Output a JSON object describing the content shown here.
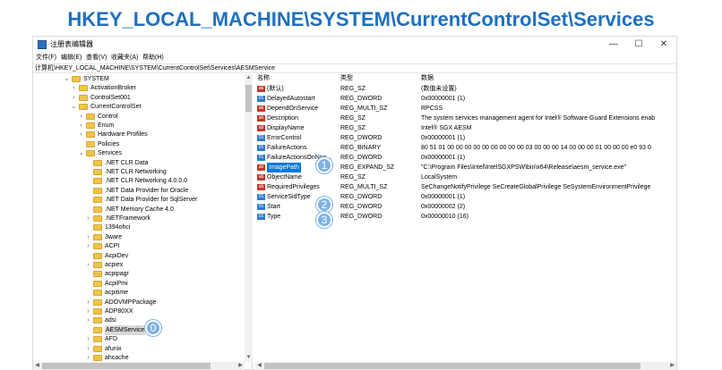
{
  "heading": "HKEY_LOCAL_MACHINE\\SYSTEM\\CurrentControlSet\\Services",
  "window": {
    "title": "注册表编辑器",
    "controls": {
      "minimize": "—",
      "maximize": "☐",
      "close": "✕"
    }
  },
  "menu": [
    "文件(F)",
    "编辑(E)",
    "查看(V)",
    "收藏夹(A)",
    "帮助(H)"
  ],
  "address": "计算机\\HKEY_LOCAL_MACHINE\\SYSTEM\\CurrentControlSet\\Services\\AESMService",
  "tree": [
    {
      "label": "SYSTEM",
      "twisty": "⌄",
      "folder": true
    },
    {
      "label": "ActivationBroker",
      "twisty": "›",
      "folder": true
    },
    {
      "label": "ControlSet001",
      "twisty": "›",
      "folder": true
    },
    {
      "label": "CurrentControlSet",
      "twisty": "⌄",
      "folder": true
    },
    {
      "label": "Control",
      "twisty": "›",
      "folder": true
    },
    {
      "label": "Enum",
      "twisty": "›",
      "folder": true
    },
    {
      "label": "Hardware Profiles",
      "twisty": "›",
      "folder": true
    },
    {
      "label": "Policies",
      "twisty": "",
      "folder": true
    },
    {
      "label": "Services",
      "twisty": "⌄",
      "folder": true
    },
    {
      "label": ".NET CLR Data",
      "twisty": "",
      "folder": true
    },
    {
      "label": ".NET CLR Networking",
      "twisty": "",
      "folder": true
    },
    {
      "label": ".NET CLR Networking 4.0.0.0",
      "twisty": "",
      "folder": true
    },
    {
      "label": ".NET Data Provider for Oracle",
      "twisty": "",
      "folder": true
    },
    {
      "label": ".NET Data Provider for SqlServer",
      "twisty": "",
      "folder": true
    },
    {
      "label": ".NET Memory Cache 4.0",
      "twisty": "",
      "folder": true
    },
    {
      "label": ".NETFramework",
      "twisty": "›",
      "folder": true
    },
    {
      "label": "1394ohci",
      "twisty": "",
      "folder": true
    },
    {
      "label": "3ware",
      "twisty": "›",
      "folder": true
    },
    {
      "label": "ACPI",
      "twisty": "›",
      "folder": true
    },
    {
      "label": "AcpiDev",
      "twisty": "",
      "folder": true
    },
    {
      "label": "acpiex",
      "twisty": "›",
      "folder": true
    },
    {
      "label": "acpipagr",
      "twisty": "",
      "folder": true
    },
    {
      "label": "AcpiPmi",
      "twisty": "",
      "folder": true
    },
    {
      "label": "acpitime",
      "twisty": "",
      "folder": true
    },
    {
      "label": "ADOVMPPackage",
      "twisty": "›",
      "folder": true
    },
    {
      "label": "ADP80XX",
      "twisty": "›",
      "folder": true
    },
    {
      "label": "adsi",
      "twisty": "›",
      "folder": true
    },
    {
      "label": "AESMService",
      "twisty": "",
      "folder": true,
      "selected": true
    },
    {
      "label": "AFD",
      "twisty": "›",
      "folder": true
    },
    {
      "label": "afunix",
      "twisty": "›",
      "folder": true
    },
    {
      "label": "ahcache",
      "twisty": "›",
      "folder": true
    }
  ],
  "columns": {
    "name": "名称",
    "type": "类型",
    "data": "数据"
  },
  "values": [
    {
      "icon": "ab",
      "kind": "sz",
      "name": "(默认)",
      "type": "REG_SZ",
      "data": "(数值未设置)"
    },
    {
      "icon": "01",
      "kind": "bin",
      "name": "DelayedAutostart",
      "type": "REG_DWORD",
      "data": "0x00000001 (1)"
    },
    {
      "icon": "ab",
      "kind": "sz",
      "name": "DependOnService",
      "type": "REG_MULTI_SZ",
      "data": "RPCSS"
    },
    {
      "icon": "ab",
      "kind": "sz",
      "name": "Description",
      "type": "REG_SZ",
      "data": "The system services management agent for Intel® Software Guard Extensions enab"
    },
    {
      "icon": "ab",
      "kind": "sz",
      "name": "DisplayName",
      "type": "REG_SZ",
      "data": "Intel® SGX AESM"
    },
    {
      "icon": "01",
      "kind": "bin",
      "name": "ErrorControl",
      "type": "REG_DWORD",
      "data": "0x00000001 (1)"
    },
    {
      "icon": "01",
      "kind": "bin",
      "name": "FailureActions",
      "type": "REG_BINARY",
      "data": "80 51 01 00 00 00 00 00 00 00 00 00 03 00 00 00 14 00 00 00 01 00 00 00 e0 93 0"
    },
    {
      "icon": "01",
      "kind": "bin",
      "name": "FailureActionsOnNon...",
      "type": "REG_DWORD",
      "data": "0x00000001 (1)"
    },
    {
      "icon": "ab",
      "kind": "sz",
      "name": "ImagePath",
      "type": "REG_EXPAND_SZ",
      "data": "\"C:\\Program Files\\Intel\\IntelSGXPSW\\bin\\x64\\Release\\aesm_service.exe\"",
      "selected": true
    },
    {
      "icon": "ab",
      "kind": "sz",
      "name": "ObjectName",
      "type": "REG_SZ",
      "data": "LocalSystem"
    },
    {
      "icon": "ab",
      "kind": "sz",
      "name": "RequiredPrivileges",
      "type": "REG_MULTI_SZ",
      "data": "SeChangeNotifyPrivilege SeCreateGlobalPrivilege SeSystemEnvironmentPrivilege"
    },
    {
      "icon": "01",
      "kind": "bin",
      "name": "ServiceSidType",
      "type": "REG_DWORD",
      "data": "0x00000001 (1)"
    },
    {
      "icon": "01",
      "kind": "bin",
      "name": "Start",
      "type": "REG_DWORD",
      "data": "0x00000002 (2)"
    },
    {
      "icon": "01",
      "kind": "bin",
      "name": "Type",
      "type": "REG_DWORD",
      "data": "0x00000010 (16)"
    }
  ],
  "badges": [
    "0",
    "1",
    "2",
    "3"
  ],
  "scroll": {
    "up": "▲",
    "down": "▼",
    "left": "◀",
    "right": "▶"
  }
}
